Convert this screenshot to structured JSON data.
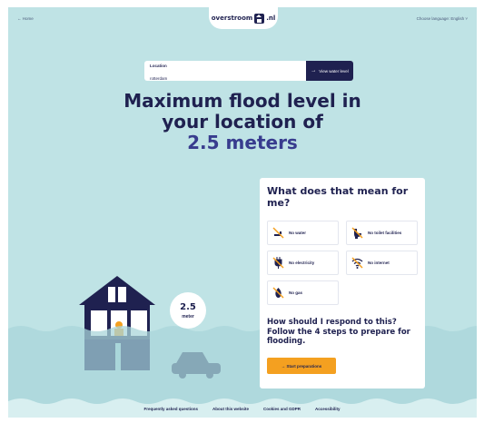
{
  "nav": {
    "home_label": "← Home",
    "logo_text": "overstroom",
    "logo_suffix": ".nl",
    "language_label": "Choose language: English ˅"
  },
  "search": {
    "label": "Location",
    "value": "rotterdam",
    "button_label": "View water level",
    "button_icon": "arrow-right"
  },
  "headline": {
    "text": "Maximum flood level in your location of",
    "level": "2.5 meters"
  },
  "marker": {
    "value": "2.5",
    "unit": "meter"
  },
  "card": {
    "title": "What does that mean for me?",
    "impacts": [
      {
        "label": "No water",
        "icon": "no-water-icon"
      },
      {
        "label": "No toilet facilities",
        "icon": "no-toilet-icon"
      },
      {
        "label": "No electricity",
        "icon": "no-electricity-icon"
      },
      {
        "label": "No internet",
        "icon": "no-internet-icon"
      },
      {
        "label": "No gas",
        "icon": "no-gas-icon"
      }
    ],
    "respond_text": "How should I respond to this? Follow the 4 steps to prepare for flooding.",
    "start_button": "→ Start preparations"
  },
  "footer": {
    "links": [
      "Frequently asked questions",
      "About this website",
      "Cookies and GDPR",
      "Accessibility"
    ]
  },
  "colors": {
    "background": "#bfe3e5",
    "navy": "#1f2150",
    "accent_orange": "#f4a020",
    "water": "#a9d6da"
  }
}
